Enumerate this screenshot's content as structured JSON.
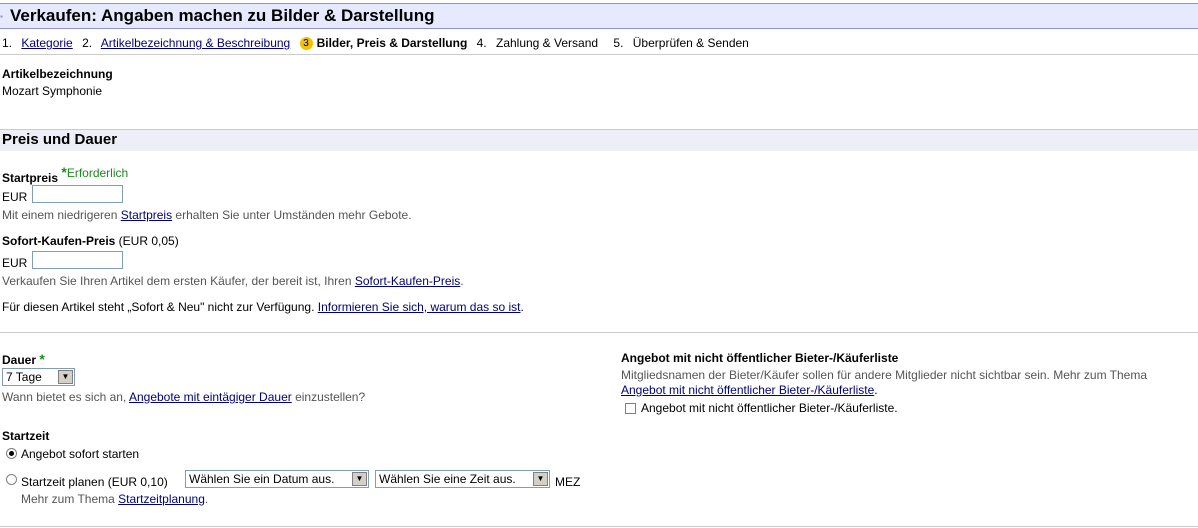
{
  "header": {
    "title": "Verkaufen: Angaben machen zu Bilder & Darstellung"
  },
  "steps": [
    {
      "num": "1.",
      "label": "Kategorie"
    },
    {
      "num": "2.",
      "label": "Artikelbezeichnung & Beschreibung"
    },
    {
      "num": "3",
      "label": "Bilder, Preis & Darstellung"
    },
    {
      "num": "4.",
      "label": "Zahlung & Versand"
    },
    {
      "num": "5.",
      "label": "Überprüfen & Senden"
    }
  ],
  "article": {
    "label": "Artikelbezeichnung",
    "value": "Mozart Symphonie"
  },
  "section_price": {
    "title": "Preis und Dauer"
  },
  "startprice": {
    "label": "Startpreis",
    "required": "Erforderlich",
    "currency": "EUR",
    "value": "",
    "hint_pre": "Mit einem niedrigeren ",
    "hint_link": "Startpreis",
    "hint_post": " erhalten Sie unter Umständen mehr Gebote."
  },
  "buynow": {
    "label": "Sofort-Kaufen-Preis",
    "fee": " (EUR 0,05)",
    "currency": "EUR",
    "value": "",
    "hint_pre": "Verkaufen Sie Ihren Artikel dem ersten Käufer, der bereit ist, Ihren ",
    "hint_link": "Sofort-Kaufen-Preis",
    "hint_post": "."
  },
  "notice": {
    "text": "Für diesen Artikel steht „Sofort & Neu\" nicht zur Verfügung. ",
    "link": "Informieren Sie sich, warum das so ist",
    "post": "."
  },
  "duration": {
    "label": "Dauer",
    "selected": "7 Tage",
    "hint_pre": "Wann bietet es sich an, ",
    "hint_link": "Angebote mit eintägiger Dauer",
    "hint_post": " einzustellen?"
  },
  "private_listing": {
    "label": "Angebot mit nicht öffentlicher Bieter-/Käuferliste",
    "desc": "Mitgliedsnamen der Bieter/Käufer sollen für andere Mitglieder nicht sichtbar sein. Mehr zum Thema",
    "link": "Angebot mit nicht öffentlicher Bieter-/Käuferliste",
    "link_post": ".",
    "checkbox_label": "Angebot mit nicht öffentlicher Bieter-/Käuferliste."
  },
  "starttime": {
    "label": "Startzeit",
    "option_now": "Angebot sofort starten",
    "option_plan": "Startzeit planen (EUR 0,10)",
    "date_select": "Wählen Sie ein Datum aus.",
    "time_select": "Wählen Sie eine Zeit aus.",
    "timezone": "MEZ",
    "more_pre": "Mehr zum Thema ",
    "more_link": "Startzeitplanung",
    "more_post": "."
  }
}
